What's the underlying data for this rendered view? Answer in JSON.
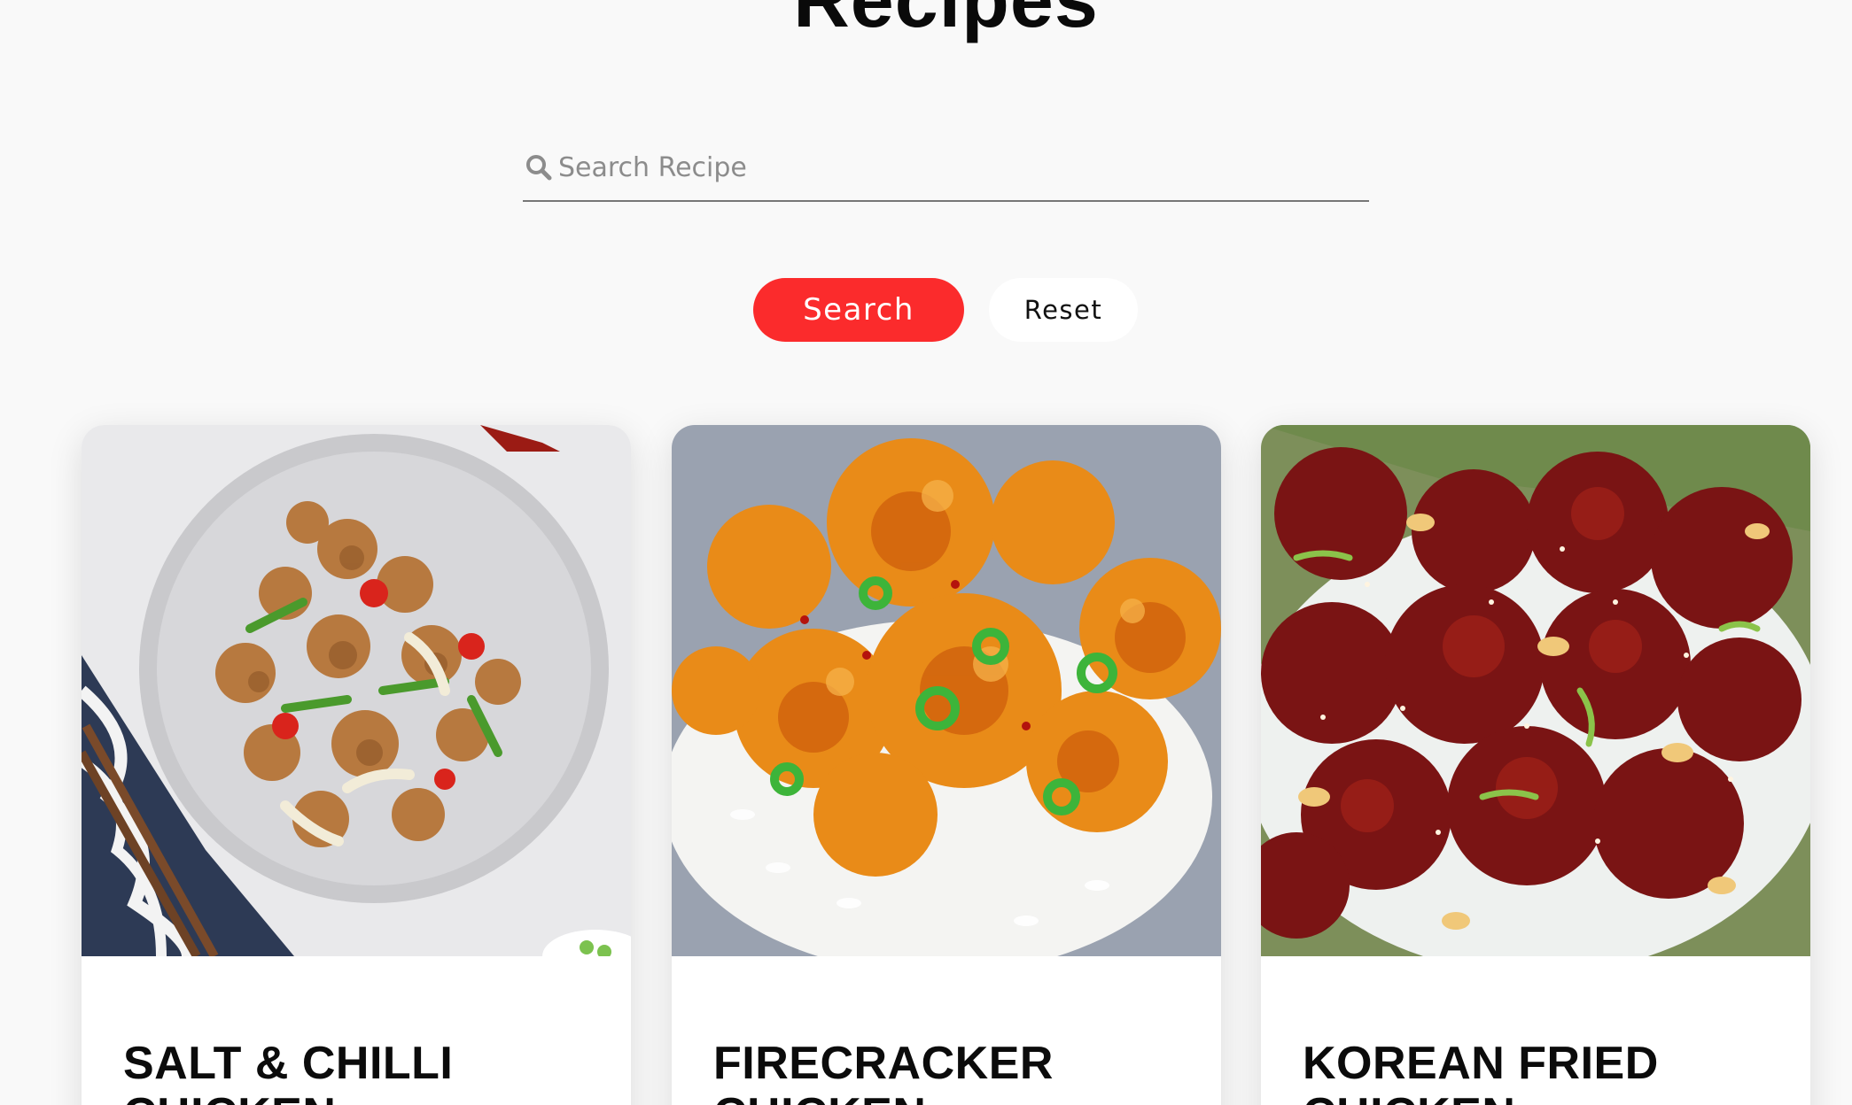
{
  "page": {
    "title": "Recipes"
  },
  "search": {
    "placeholder": "Search Recipe",
    "icon": "search-icon",
    "search_button_label": "Search",
    "reset_button_label": "Reset"
  },
  "colors": {
    "accent": "#fb2b2c",
    "background": "#f9f9f9",
    "card": "#ffffff"
  },
  "recipes": [
    {
      "title": "SALT & CHILLI CHICKEN",
      "image": "salt-and-chilli-chicken-photo"
    },
    {
      "title": "FIRECRACKER CHICKEN",
      "image": "firecracker-chicken-photo"
    },
    {
      "title": "KOREAN FRIED CHICKEN",
      "image": "korean-fried-chicken-photo"
    }
  ]
}
